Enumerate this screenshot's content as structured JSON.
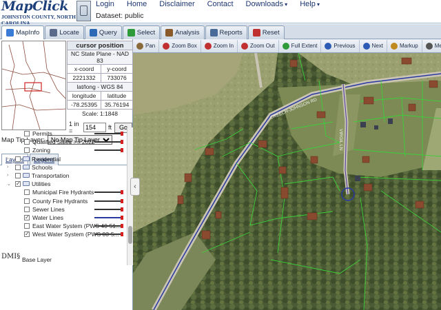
{
  "header": {
    "logo_title": "MapClick",
    "logo_subtitle": "JOHNSTON COUNTY, NORTH CAROLINA",
    "nav": [
      "Login",
      "Home",
      "Disclaimer",
      "Contact",
      "Downloads",
      "Help"
    ],
    "dataset": "Dataset: public"
  },
  "tabs": [
    {
      "label": "MapInfo",
      "icon": "map-icon",
      "color": "#3a7bd5"
    },
    {
      "label": "Locate",
      "icon": "locate-icon",
      "color": "#5a6a8a"
    },
    {
      "label": "Query",
      "icon": "query-icon",
      "color": "#2d6ab5"
    },
    {
      "label": "Select",
      "icon": "select-icon",
      "color": "#2e9a3a"
    },
    {
      "label": "Analysis",
      "icon": "analysis-icon",
      "color": "#8a5a2a"
    },
    {
      "label": "Reports",
      "icon": "reports-icon",
      "color": "#4a6a9a"
    },
    {
      "label": "Reset",
      "icon": "reset-icon",
      "color": "#c03030"
    }
  ],
  "cursor": {
    "title": "cursor position",
    "plane": "NC State Plane - NAD 83",
    "xlabel": "x-coord",
    "ylabel": "y-coord",
    "x": "2221332",
    "y": "733076",
    "wgs": "lat/long - WGS 84",
    "lonlabel": "longitude",
    "latlabel": "latitude",
    "lon": "-78.25395",
    "lat": "35.76194"
  },
  "scale": {
    "label": "Scale: 1:1848",
    "prefix": "1 in =",
    "value": "154",
    "unit": "ft",
    "go": "Go"
  },
  "maptip": {
    "label": "Map Tip Layer:",
    "selected": "No Map Tip Layer"
  },
  "layer_tabs": [
    "Layers",
    "Legend"
  ],
  "layers": [
    {
      "label": "Permits",
      "indent": 2,
      "checked": false,
      "type": "item",
      "sym": "red"
    },
    {
      "label": "Qualified Sales >= 2022",
      "indent": 2,
      "checked": false,
      "type": "item",
      "sym": "red"
    },
    {
      "label": "Zoning",
      "indent": 2,
      "checked": false,
      "type": "item",
      "sym": "red"
    },
    {
      "label": "Residential",
      "indent": 1,
      "checked": false,
      "type": "folder"
    },
    {
      "label": "Schools",
      "indent": 1,
      "checked": false,
      "type": "folder"
    },
    {
      "label": "Transportation",
      "indent": 1,
      "checked": false,
      "type": "folder"
    },
    {
      "label": "Utilities",
      "indent": 1,
      "checked": true,
      "type": "folder",
      "open": true
    },
    {
      "label": "Municipal Fire Hydrants",
      "indent": 2,
      "checked": false,
      "type": "item",
      "sym": "red"
    },
    {
      "label": "County Fire Hydrants",
      "indent": 2,
      "checked": false,
      "type": "item",
      "sym": "red"
    },
    {
      "label": "Sewer Lines",
      "indent": 2,
      "checked": false,
      "type": "item",
      "sym": "red"
    },
    {
      "label": "Water Lines",
      "indent": 2,
      "checked": true,
      "type": "item",
      "sym": "blue"
    },
    {
      "label": "East Water System (PWS 40-51...",
      "indent": 2,
      "checked": false,
      "type": "item",
      "sym": "red"
    },
    {
      "label": "West Water System (PWS 03-5...",
      "indent": 2,
      "checked": true,
      "type": "item",
      "sym": "red"
    }
  ],
  "base_layer": "Base Layer",
  "dmis": "DMI§",
  "map_tools": [
    {
      "label": "Pan",
      "icon": "pan-icon",
      "color": "#8a6a3a"
    },
    {
      "label": "Zoom Box",
      "icon": "zoom-box-icon",
      "color": "#c03030"
    },
    {
      "label": "Zoom In",
      "icon": "zoom-in-icon",
      "color": "#c03030"
    },
    {
      "label": "Zoom Out",
      "icon": "zoom-out-icon",
      "color": "#c03030"
    },
    {
      "label": "Full Extent",
      "icon": "full-extent-icon",
      "color": "#2e9a3a"
    },
    {
      "label": "Previous",
      "icon": "previous-icon",
      "color": "#2d5ab5"
    },
    {
      "label": "Next",
      "icon": "next-icon",
      "color": "#2d5ab5"
    },
    {
      "label": "Markup",
      "icon": "markup-icon",
      "color": "#c08a20"
    },
    {
      "label": "Measure",
      "icon": "measure-icon",
      "color": "#555"
    }
  ],
  "map_labels": {
    "road1": "CREECH-JOHNSON RD",
    "road2": "VIRGIL LN"
  }
}
